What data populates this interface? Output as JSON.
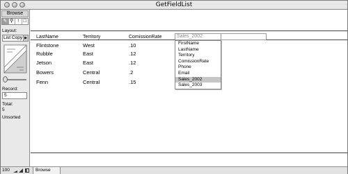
{
  "window": {
    "title": "GetFieldList"
  },
  "status_area": {
    "mode": "Browse",
    "layout_label": "Layout:",
    "layout_value": "List Copy",
    "record_label": "Record:",
    "record_value": "5",
    "total_label": "Total:",
    "total_value": "5",
    "sort_status": "Unsorted"
  },
  "table": {
    "headers": {
      "lastname": "LastName",
      "territory": "Territory",
      "commission": "ComissionRate"
    },
    "rows": [
      {
        "lastname": "Flintstone",
        "territory": "West",
        "commission": ".10"
      },
      {
        "lastname": "Rubble",
        "territory": "East",
        "commission": ".12"
      },
      {
        "lastname": "Jetson",
        "territory": "East",
        "commission": ".12"
      },
      {
        "lastname": "Bowers",
        "territory": "Central",
        "commission": ".2"
      },
      {
        "lastname": "Fenn",
        "territory": "Central",
        "commission": ".15"
      }
    ]
  },
  "field_picker": {
    "value": "Sales_2002",
    "options": [
      "FirstName",
      "LastName",
      "Territory",
      "ComissionRate",
      "Phone",
      "Email",
      "Sales_2002",
      "Sales_2003"
    ],
    "highlighted": "Sales_2002"
  },
  "bottom_bar": {
    "zoom": "100",
    "mode": "Browse"
  },
  "icons": {
    "tools": [
      "browse-tool-icon",
      "find-tool-icon",
      "layout-tool-icon",
      "preview-tool-icon"
    ],
    "book": "record-book-icon"
  }
}
